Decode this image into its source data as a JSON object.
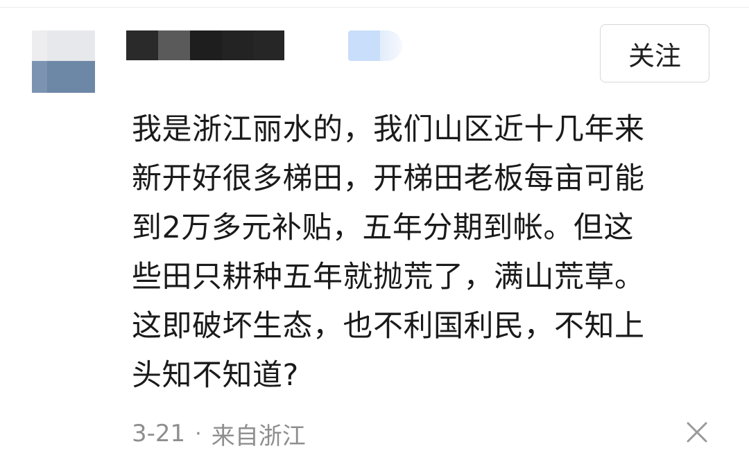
{
  "header": {
    "follow_label": "关注"
  },
  "comment": {
    "lines": [
      "我是浙江丽水的，我们山区近十几年来",
      "新开好很多梯田，开梯田老板每亩可能",
      "到2万多元补贴，五年分期到帐。但这",
      "些田只耕种五年就抛荒了，满山荒草。",
      "这即破坏生态，也不利国利民，不知上",
      "头知不知道?"
    ]
  },
  "meta": {
    "date": "3-21",
    "separator": "·",
    "location": "来自浙江"
  },
  "icons": {
    "close": "close-icon"
  },
  "colors": {
    "text": "#1a1a1a",
    "meta": "#8e8e8e",
    "button_border": "#d7d7d7"
  }
}
